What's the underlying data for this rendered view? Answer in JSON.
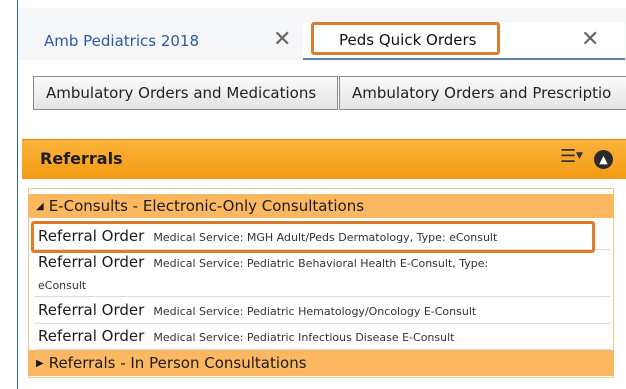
{
  "tabs": [
    {
      "label": "Amb Pediatrics 2018",
      "close": "✕"
    },
    {
      "label": "Peds Quick Orders",
      "close": "✕"
    }
  ],
  "buttons": [
    {
      "label": "Ambulatory Orders and Medications"
    },
    {
      "label": "Ambulatory Orders and Prescriptio"
    }
  ],
  "panel": {
    "title": "Referrals",
    "icons": {
      "menu": "menu-icon",
      "collapse": "collapse-icon"
    },
    "groups": [
      {
        "label": "E-Consults - Electronic-Only Consultations",
        "expanded": true,
        "arrow": "◢"
      },
      {
        "label": "Referrals - In Person Consultations",
        "expanded": false,
        "arrow": "▶"
      }
    ],
    "items": [
      {
        "name": "Referral Order",
        "desc": "Medical Service: MGH Adult/Peds Dermatology, Type: eConsult"
      },
      {
        "name": "Referral Order",
        "desc": "Medical Service: Pediatric Behavioral Health E-Consult, Type:",
        "desc2": "eConsult"
      },
      {
        "name": "Referral Order",
        "desc": "Medical Service: Pediatric Hematology/Oncology E-Consult"
      },
      {
        "name": "Referral Order",
        "desc": "Medical Service: Pediatric Infectious Disease E-Consult"
      }
    ]
  },
  "colors": {
    "accent_orange": "#f39a12",
    "highlight_box": "#e07b2a",
    "tab_link": "#2a5aa0"
  }
}
